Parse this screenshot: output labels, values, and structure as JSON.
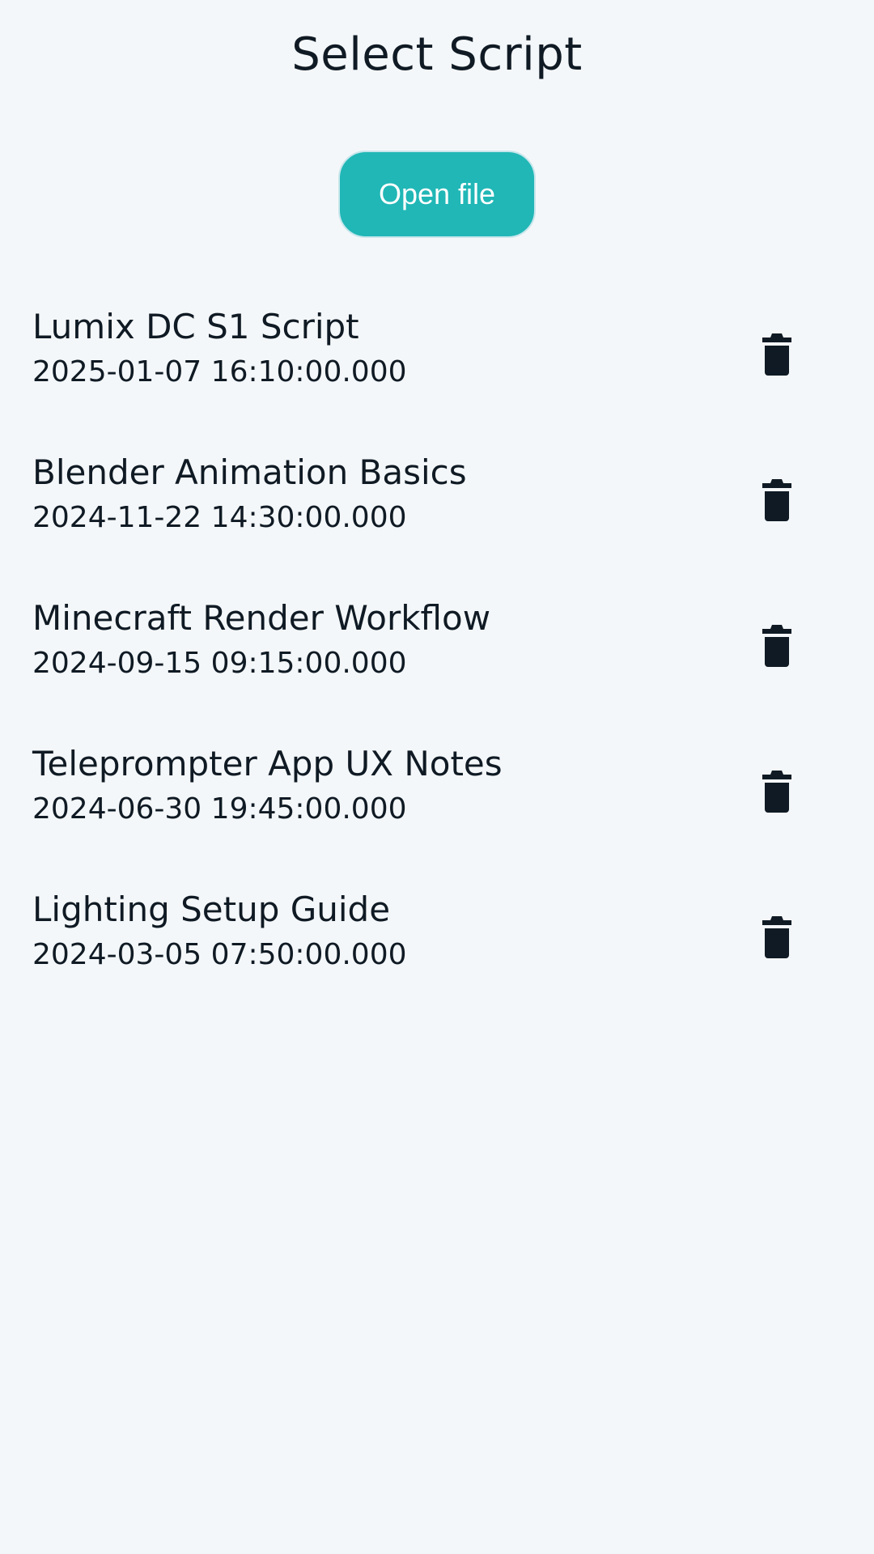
{
  "header": {
    "title": "Select Script"
  },
  "actions": {
    "open_file_label": "Open file"
  },
  "scripts": [
    {
      "title": "Lumix DC S1 Script",
      "date": "2025-01-07 16:10:00.000"
    },
    {
      "title": "Blender Animation Basics",
      "date": "2024-11-22 14:30:00.000"
    },
    {
      "title": "Minecraft Render Workflow",
      "date": "2024-09-15 09:15:00.000"
    },
    {
      "title": "Teleprompter App UX Notes",
      "date": "2024-06-30 19:45:00.000"
    },
    {
      "title": "Lighting Setup Guide",
      "date": "2024-03-05 07:50:00.000"
    }
  ],
  "icons": {
    "delete": "trash-icon"
  },
  "colors": {
    "background": "#f4f7f9",
    "accent": "#20b7b6",
    "text": "#0f1a24"
  }
}
